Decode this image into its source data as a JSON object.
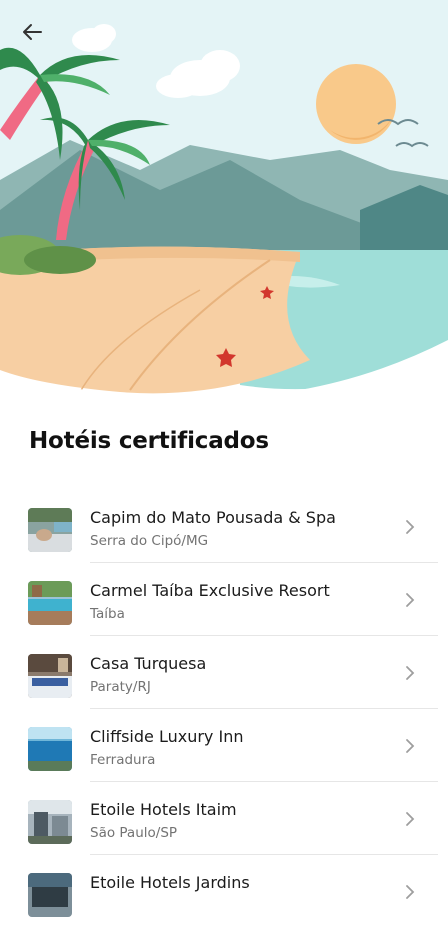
{
  "header": {
    "back_icon": "arrow-left-icon"
  },
  "section": {
    "title": "Hotéis certificados"
  },
  "hotels": [
    {
      "name": "Capim do Mato Pousada & Spa",
      "location": "Serra do Cipó/MG",
      "thumb": "spa-photo"
    },
    {
      "name": "Carmel Taíba Exclusive Resort",
      "location": "Taíba",
      "thumb": "resort-pool-photo"
    },
    {
      "name": "Casa Turquesa",
      "location": "Paraty/RJ",
      "thumb": "bedroom-photo"
    },
    {
      "name": "Cliffside Luxury Inn",
      "location": "Ferradura",
      "thumb": "sea-view-photo"
    },
    {
      "name": "Etoile Hotels Itaim",
      "location": "São Paulo/SP",
      "thumb": "city-hotel-photo"
    },
    {
      "name": "Etoile Hotels Jardins",
      "location": "",
      "thumb": "city-hotel-photo"
    }
  ],
  "colors": {
    "sky": "#e3f3f5",
    "sand": "#f7cfa3",
    "sea": "#9fded8",
    "sun": "#f9c98a",
    "text": "#1b1b1b",
    "subtext": "#737373"
  }
}
